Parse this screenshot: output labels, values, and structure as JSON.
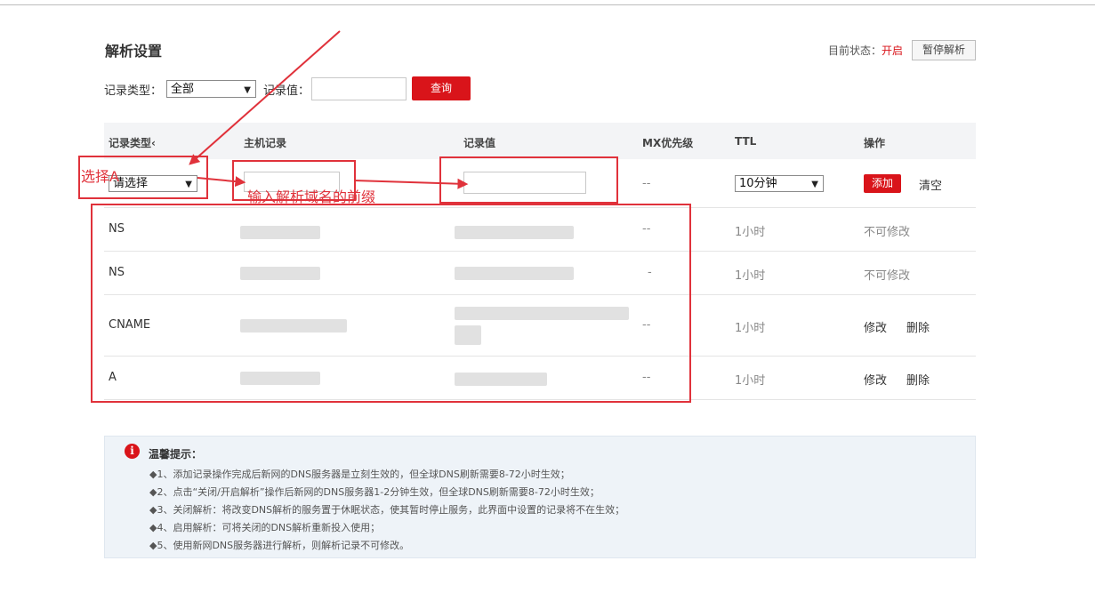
{
  "header": {
    "title": "解析设置",
    "status_label": "目前状态：",
    "status_value": "开启",
    "pause_button": "暂停解析"
  },
  "filter": {
    "type_label": "记录类型：",
    "type_selected": "全部",
    "value_label": "记录值：",
    "value_input": "",
    "query_button": "查询"
  },
  "table": {
    "columns": [
      "记录类型‹",
      "主机记录",
      "记录值",
      "MX优先级",
      "TTL",
      "操作"
    ],
    "new_row": {
      "type_selected": "请选择",
      "host_value": "",
      "record_value": "",
      "mx": "--",
      "ttl_selected": "10分钟",
      "add_button": "添加",
      "clear_link": "清空"
    },
    "rows": [
      {
        "type": "NS",
        "mx": "--",
        "ttl": "1小时",
        "action1": "不可修改",
        "action2": ""
      },
      {
        "type": "NS",
        "mx": "-",
        "ttl": "1小时",
        "action1": "不可修改",
        "action2": ""
      },
      {
        "type": "CNAME",
        "mx": "--",
        "ttl": "1小时",
        "action1": "修改",
        "action2": "删除"
      },
      {
        "type": "A",
        "mx": "--",
        "ttl": "1小时",
        "action1": "修改",
        "action2": "删除"
      }
    ]
  },
  "annotations": {
    "select_a": "选择A",
    "input_prefix": "输入解析域名的前缀",
    "color": "#e0323b"
  },
  "tips": {
    "title": "温馨提示：",
    "icon": "info-icon",
    "lines": [
      "◆1、添加记录操作完成后新网的DNS服务器是立刻生效的，但全球DNS刷新需要8-72小时生效；",
      "◆2、点击“关闭/开启解析”操作后新网的DNS服务器1-2分钟生效，但全球DNS刷新需要8-72小时生效；",
      "◆3、关闭解析：将改变DNS解析的服务置于休眠状态，使其暂时停止服务，此界面中设置的记录将不在生效；",
      "◆4、启用解析：可将关闭的DNS解析重新投入使用；",
      "◆5、使用新网DNS服务器进行解析，则解析记录不可修改。"
    ]
  },
  "colors": {
    "accent": "#d9141a",
    "header_bg": "#f3f4f6",
    "tips_bg": "#eef3f8"
  }
}
